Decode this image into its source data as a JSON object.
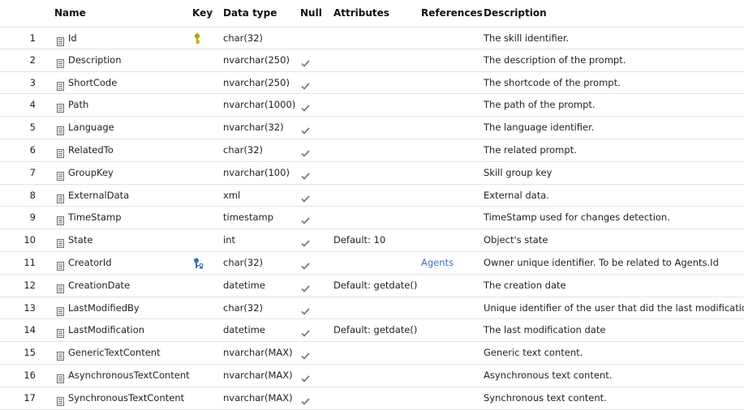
{
  "columns": {
    "name": "Name",
    "key": "Key",
    "type": "Data type",
    "null": "Null",
    "attributes": "Attributes",
    "references": "References",
    "description": "Description"
  },
  "rows": [
    {
      "num": "1",
      "name": "Id",
      "key": "primary",
      "type": "char(32)",
      "nullable": false,
      "attr": "",
      "ref": "",
      "desc": "The skill identifier."
    },
    {
      "num": "2",
      "name": "Description",
      "key": "",
      "type": "nvarchar(250)",
      "nullable": true,
      "attr": "",
      "ref": "",
      "desc": "The description of the prompt."
    },
    {
      "num": "3",
      "name": "ShortCode",
      "key": "",
      "type": "nvarchar(250)",
      "nullable": true,
      "attr": "",
      "ref": "",
      "desc": "The shortcode of the prompt."
    },
    {
      "num": "4",
      "name": "Path",
      "key": "",
      "type": "nvarchar(1000)",
      "nullable": true,
      "attr": "",
      "ref": "",
      "desc": "The path of the prompt."
    },
    {
      "num": "5",
      "name": "Language",
      "key": "",
      "type": "nvarchar(32)",
      "nullable": true,
      "attr": "",
      "ref": "",
      "desc": "The language identifier."
    },
    {
      "num": "6",
      "name": "RelatedTo",
      "key": "",
      "type": "char(32)",
      "nullable": true,
      "attr": "",
      "ref": "",
      "desc": "The related prompt."
    },
    {
      "num": "7",
      "name": "GroupKey",
      "key": "",
      "type": "nvarchar(100)",
      "nullable": true,
      "attr": "",
      "ref": "",
      "desc": "Skill group key"
    },
    {
      "num": "8",
      "name": "ExternalData",
      "key": "",
      "type": "xml",
      "nullable": true,
      "attr": "",
      "ref": "",
      "desc": "External data."
    },
    {
      "num": "9",
      "name": "TimeStamp",
      "key": "",
      "type": "timestamp",
      "nullable": true,
      "attr": "",
      "ref": "",
      "desc": "TimeStamp used for changes detection."
    },
    {
      "num": "10",
      "name": "State",
      "key": "",
      "type": "int",
      "nullable": true,
      "attr": "Default: 10",
      "ref": "",
      "desc": "Object's state"
    },
    {
      "num": "11",
      "name": "CreatorId",
      "key": "foreign",
      "type": "char(32)",
      "nullable": true,
      "attr": "",
      "ref": "Agents",
      "desc": "Owner unique identifier. To be related to Agents.Id"
    },
    {
      "num": "12",
      "name": "CreationDate",
      "key": "",
      "type": "datetime",
      "nullable": true,
      "attr": "Default: getdate()",
      "ref": "",
      "desc": "The creation date"
    },
    {
      "num": "13",
      "name": "LastModifiedBy",
      "key": "",
      "type": "char(32)",
      "nullable": true,
      "attr": "",
      "ref": "",
      "desc": "Unique identifier of the user that did the last modifications"
    },
    {
      "num": "14",
      "name": "LastModification",
      "key": "",
      "type": "datetime",
      "nullable": true,
      "attr": "Default: getdate()",
      "ref": "",
      "desc": "The last modification date"
    },
    {
      "num": "15",
      "name": "GenericTextContent",
      "key": "",
      "type": "nvarchar(MAX)",
      "nullable": true,
      "attr": "",
      "ref": "",
      "desc": "Generic text content."
    },
    {
      "num": "16",
      "name": "AsynchronousTextContent",
      "key": "",
      "type": "nvarchar(MAX)",
      "nullable": true,
      "attr": "",
      "ref": "",
      "desc": "Asynchronous text content."
    },
    {
      "num": "17",
      "name": "SynchronousTextContent",
      "key": "",
      "type": "nvarchar(MAX)",
      "nullable": true,
      "attr": "",
      "ref": "",
      "desc": "Synchronous text content."
    }
  ],
  "icons": {
    "column": "column-icon",
    "primary_key": "primary-key-icon",
    "foreign_key": "foreign-key-icon",
    "nullable": "checkmark-icon"
  },
  "colors": {
    "key_gold": "#b8a400",
    "fk_blue": "#3b6fb6",
    "link": "#3b6fb6",
    "check": "#7a7a7a",
    "grid": "#e3e3e3"
  }
}
